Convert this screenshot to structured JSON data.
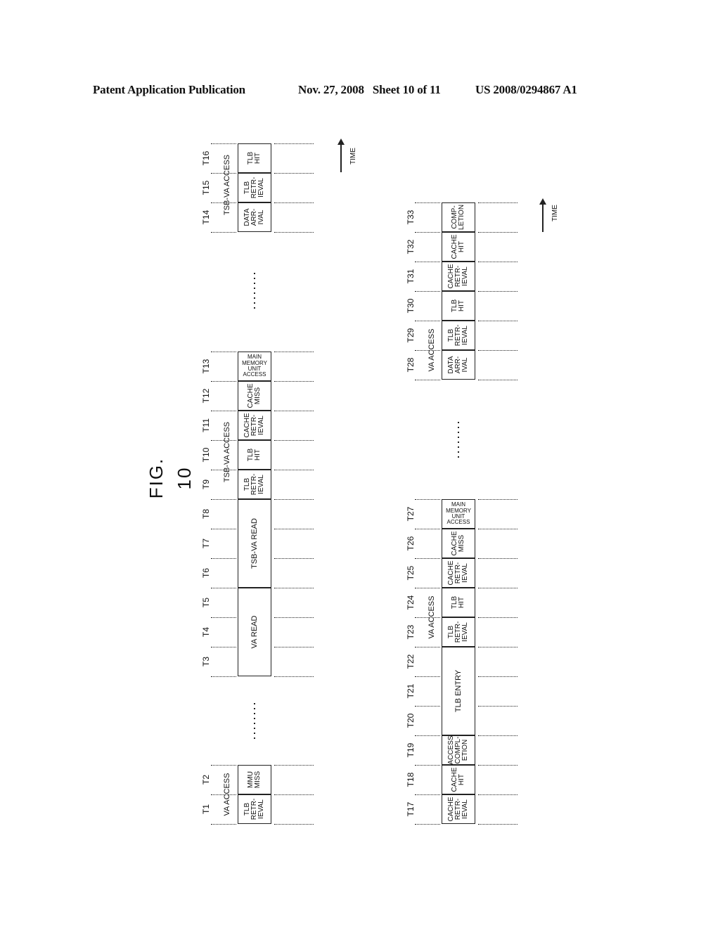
{
  "header": {
    "publication": "Patent Application Publication",
    "date_sheet": "Nov. 27, 2008   Sheet 10 of 11",
    "number": "US 2008/0294867 A1"
  },
  "figure": {
    "title": "FIG. 10",
    "time_axis_label": "TIME",
    "ellipsis": "........",
    "left_diagram": {
      "segments": [
        {
          "access_label": "VA ACCESS",
          "slots": [
            "T1",
            "T2"
          ],
          "blocks": [
            {
              "label": "TLB\nRETR-\nIEVAL",
              "slots": [
                "T1"
              ]
            },
            {
              "label": "MMU\nMISS",
              "slots": [
                "T2"
              ]
            }
          ]
        },
        {
          "access_label": "",
          "slots": [
            "T3",
            "T4",
            "T5",
            "T6",
            "T7",
            "T8"
          ],
          "blocks": [
            {
              "label": "VA READ",
              "slots": [
                "T3",
                "T4",
                "T5"
              ]
            },
            {
              "label": "TSB-VA READ",
              "slots": [
                "T6",
                "T7",
                "T8"
              ]
            }
          ]
        },
        {
          "access_label": "TSB-VA ACCESS",
          "slots": [
            "T9",
            "T10",
            "T11",
            "T12",
            "T13"
          ],
          "blocks": [
            {
              "label": "TLB\nRETR-\nIEVAL",
              "slots": [
                "T9"
              ]
            },
            {
              "label": "TLB\nHIT",
              "slots": [
                "T10"
              ]
            },
            {
              "label": "CACHE\nRETR-\nIEVAL",
              "slots": [
                "T11"
              ]
            },
            {
              "label": "CACHE\nMISS",
              "slots": [
                "T12"
              ]
            },
            {
              "label": "MAIN\nMEMORY\nUNIT\nACCESS",
              "slots": [
                "T13"
              ]
            }
          ]
        },
        {
          "access_label": "TSB-VA ACCESS",
          "slots": [
            "T14",
            "T15",
            "T16"
          ],
          "blocks": [
            {
              "label": "DATA\nARR-\nIVAL",
              "slots": [
                "T14"
              ]
            },
            {
              "label": "TLB\nRETR-\nIEVAL",
              "slots": [
                "T15"
              ]
            },
            {
              "label": "TLB\nHIT",
              "slots": [
                "T16"
              ]
            }
          ]
        }
      ]
    },
    "right_diagram": {
      "segments": [
        {
          "access_label": "",
          "slots": [
            "T17",
            "T18",
            "T19",
            "T20",
            "T21",
            "T22"
          ],
          "blocks": [
            {
              "label": "CACHE\nRETR-\nIEVAL",
              "slots": [
                "T17"
              ]
            },
            {
              "label": "CACHE\nHIT",
              "slots": [
                "T18"
              ]
            },
            {
              "label": "ACCESS\nCOMPL-\nETION",
              "slots": [
                "T19"
              ]
            },
            {
              "label": "TLB ENTRY",
              "slots": [
                "T20",
                "T21",
                "T22"
              ]
            }
          ]
        },
        {
          "access_label": "VA ACCESS",
          "slots": [
            "T23",
            "T24",
            "T25",
            "T26",
            "T27"
          ],
          "blocks": [
            {
              "label": "TLB\nRETR-\nIEVAL",
              "slots": [
                "T23"
              ]
            },
            {
              "label": "TLB\nHIT",
              "slots": [
                "T24"
              ]
            },
            {
              "label": "CACHE\nRETR-\nIEVAL",
              "slots": [
                "T25"
              ]
            },
            {
              "label": "CACHE\nMISS",
              "slots": [
                "T26"
              ]
            },
            {
              "label": "MAIN\nMEMORY\nUNIT\nACCESS",
              "slots": [
                "T27"
              ]
            }
          ]
        },
        {
          "access_label": "VA ACCESS",
          "slots": [
            "T28",
            "T29",
            "T30",
            "T31",
            "T32",
            "T33"
          ],
          "blocks": [
            {
              "label": "DATA\nARR-\nIVAL",
              "slots": [
                "T28"
              ]
            },
            {
              "label": "TLB\nRETR-\nIEVAL",
              "slots": [
                "T29"
              ]
            },
            {
              "label": "TLB\nHIT",
              "slots": [
                "T30"
              ]
            },
            {
              "label": "CACHE\nRETR-\nIEVAL",
              "slots": [
                "T31"
              ]
            },
            {
              "label": "CACHE\nHIT",
              "slots": [
                "T32"
              ]
            },
            {
              "label": "COMP-\nLETION",
              "slots": [
                "T33"
              ]
            }
          ]
        }
      ]
    }
  }
}
